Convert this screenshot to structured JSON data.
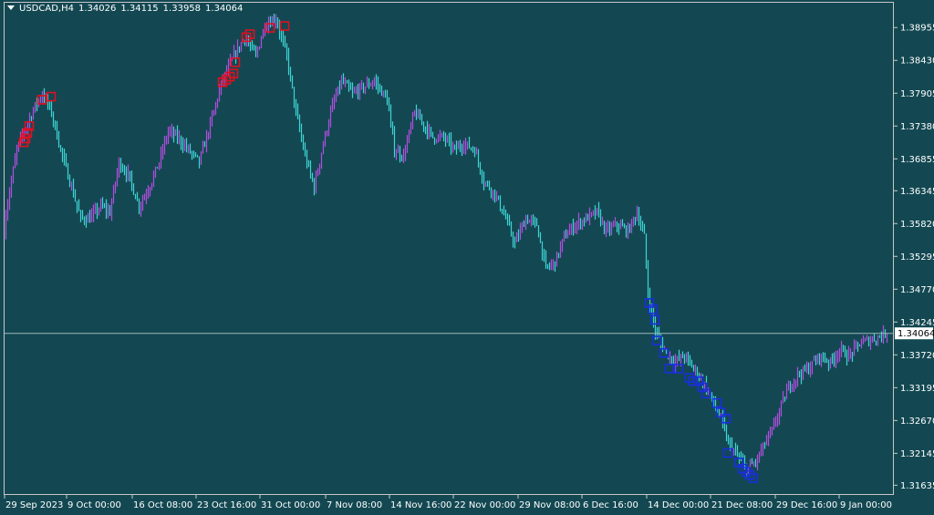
{
  "header": {
    "symbol": "USDCAD,H4",
    "open": "1.34026",
    "high": "1.34115",
    "low": "1.33958",
    "close": "1.34064"
  },
  "colors": {
    "background": "#134852",
    "bull": "#b24ee0",
    "bear": "#3fd4d4",
    "sell_marker": "#e01020",
    "buy_marker": "#1a2ee0",
    "grid_border": "#c8c8c8",
    "price_line": "#a0b8bc"
  },
  "chart_data": {
    "type": "bar",
    "ylim": [
      1.3145,
      1.3925
    ],
    "current_price": "1.34064",
    "y_ticks": [
      "1.38955",
      "1.38430",
      "1.37905",
      "1.37380",
      "1.36855",
      "1.36345",
      "1.35820",
      "1.35295",
      "1.34770",
      "1.34245",
      "1.33720",
      "1.33195",
      "1.32670",
      "1.32145",
      "1.31635"
    ],
    "x_ticks": [
      "29 Sep 2023",
      "9 Oct 00:00",
      "16 Oct 08:00",
      "23 Oct 16:00",
      "31 Oct 00:00",
      "7 Nov 08:00",
      "14 Nov 16:00",
      "22 Nov 00:00",
      "29 Nov 08:00",
      "6 Dec 16:00",
      "14 Dec 00:00",
      "21 Dec 08:00",
      "29 Dec 16:00",
      "9 Jan 00:00"
    ],
    "price_path": [
      [
        0,
        1.344
      ],
      [
        8,
        1.36
      ],
      [
        20,
        1.37
      ],
      [
        28,
        1.373
      ],
      [
        40,
        1.377
      ],
      [
        48,
        1.379
      ],
      [
        58,
        1.376
      ],
      [
        68,
        1.37
      ],
      [
        78,
        1.365
      ],
      [
        90,
        1.359
      ],
      [
        100,
        1.359
      ],
      [
        112,
        1.361
      ],
      [
        122,
        1.36
      ],
      [
        132,
        1.368
      ],
      [
        142,
        1.366
      ],
      [
        154,
        1.361
      ],
      [
        165,
        1.364
      ],
      [
        176,
        1.368
      ],
      [
        186,
        1.373
      ],
      [
        196,
        1.372
      ],
      [
        208,
        1.37
      ],
      [
        220,
        1.368
      ],
      [
        232,
        1.374
      ],
      [
        245,
        1.381
      ],
      [
        258,
        1.385
      ],
      [
        270,
        1.388
      ],
      [
        282,
        1.385
      ],
      [
        292,
        1.39
      ],
      [
        304,
        1.391
      ],
      [
        316,
        1.385
      ],
      [
        326,
        1.376
      ],
      [
        336,
        1.369
      ],
      [
        346,
        1.364
      ],
      [
        356,
        1.371
      ],
      [
        366,
        1.377
      ],
      [
        376,
        1.381
      ],
      [
        388,
        1.379
      ],
      [
        400,
        1.38
      ],
      [
        412,
        1.381
      ],
      [
        426,
        1.378
      ],
      [
        434,
        1.37
      ],
      [
        444,
        1.369
      ],
      [
        456,
        1.376
      ],
      [
        466,
        1.374
      ],
      [
        476,
        1.372
      ],
      [
        488,
        1.372
      ],
      [
        500,
        1.37
      ],
      [
        510,
        1.371
      ],
      [
        522,
        1.37
      ],
      [
        532,
        1.365
      ],
      [
        544,
        1.363
      ],
      [
        556,
        1.359
      ],
      [
        566,
        1.355
      ],
      [
        578,
        1.359
      ],
      [
        590,
        1.358
      ],
      [
        600,
        1.351
      ],
      [
        610,
        1.352
      ],
      [
        620,
        1.356
      ],
      [
        632,
        1.358
      ],
      [
        644,
        1.359
      ],
      [
        656,
        1.36
      ],
      [
        666,
        1.357
      ],
      [
        678,
        1.358
      ],
      [
        690,
        1.357
      ],
      [
        700,
        1.36
      ],
      [
        708,
        1.356
      ],
      [
        712,
        1.347
      ],
      [
        716,
        1.344
      ],
      [
        720,
        1.341
      ],
      [
        728,
        1.3385
      ],
      [
        740,
        1.336
      ],
      [
        752,
        1.337
      ],
      [
        762,
        1.335
      ],
      [
        772,
        1.333
      ],
      [
        782,
        1.33
      ],
      [
        792,
        1.327
      ],
      [
        800,
        1.323
      ],
      [
        810,
        1.321
      ],
      [
        820,
        1.319
      ],
      [
        830,
        1.32
      ],
      [
        840,
        1.323
      ],
      [
        848,
        1.325
      ],
      [
        858,
        1.329
      ],
      [
        866,
        1.332
      ],
      [
        876,
        1.334
      ],
      [
        888,
        1.335
      ],
      [
        900,
        1.337
      ],
      [
        912,
        1.336
      ],
      [
        922,
        1.338
      ],
      [
        932,
        1.337
      ],
      [
        944,
        1.339
      ],
      [
        954,
        1.3395
      ],
      [
        964,
        1.34
      ],
      [
        972,
        1.3406
      ]
    ],
    "sell_signals": [
      [
        26,
        1.3712
      ],
      [
        28,
        1.3718
      ],
      [
        30,
        1.3727
      ],
      [
        32,
        1.3738
      ],
      [
        46,
        1.378
      ],
      [
        56,
        1.3785
      ],
      [
        244,
        1.3808
      ],
      [
        248,
        1.3812
      ],
      [
        252,
        1.3817
      ],
      [
        256,
        1.3822
      ],
      [
        258,
        1.384
      ],
      [
        270,
        1.388
      ],
      [
        274,
        1.3885
      ],
      [
        296,
        1.3895
      ],
      [
        312,
        1.3898
      ]
    ],
    "buy_signals": [
      [
        712,
        1.3455
      ],
      [
        716,
        1.3445
      ],
      [
        718,
        1.3428
      ],
      [
        720,
        1.3395
      ],
      [
        728,
        1.3375
      ],
      [
        734,
        1.335
      ],
      [
        744,
        1.335
      ],
      [
        756,
        1.3335
      ],
      [
        760,
        1.333
      ],
      [
        766,
        1.333
      ],
      [
        770,
        1.332
      ],
      [
        774,
        1.331
      ],
      [
        786,
        1.3295
      ],
      [
        790,
        1.328
      ],
      [
        796,
        1.327
      ],
      [
        798,
        1.3215
      ],
      [
        810,
        1.32
      ],
      [
        814,
        1.319
      ],
      [
        818,
        1.3185
      ],
      [
        822,
        1.318
      ],
      [
        826,
        1.3175
      ]
    ]
  }
}
